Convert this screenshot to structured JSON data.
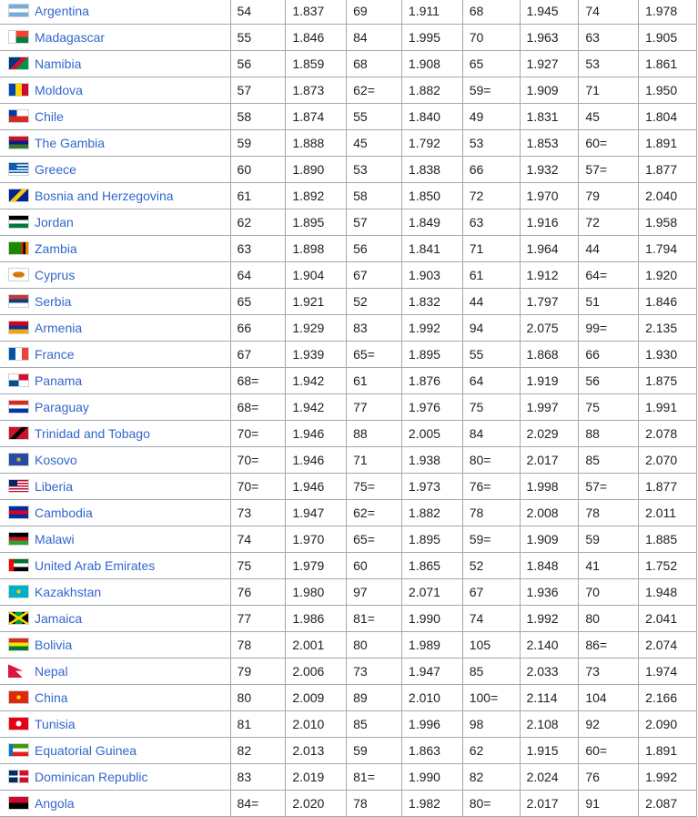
{
  "rows": [
    {
      "country": "Argentina",
      "flag": [
        "#74acdf",
        "#ffffff",
        "#74acdf"
      ],
      "dir": "h",
      "rank1": "54",
      "score1": "1.837",
      "rank2": "69",
      "score2": "1.911",
      "rank3": "68",
      "score3": "1.945",
      "rank4": "74",
      "score4": "1.978"
    },
    {
      "country": "Madagascar",
      "flag": [
        "#ffffff",
        "#fc3d32",
        "#007e3a"
      ],
      "dir": "mg",
      "rank1": "55",
      "score1": "1.846",
      "rank2": "84",
      "score2": "1.995",
      "rank3": "70",
      "score3": "1.963",
      "rank4": "63",
      "score4": "1.905"
    },
    {
      "country": "Namibia",
      "flag": [
        "#003580",
        "#d21034",
        "#009543"
      ],
      "dir": "d",
      "rank1": "56",
      "score1": "1.859",
      "rank2": "68",
      "score2": "1.908",
      "rank3": "65",
      "score3": "1.927",
      "rank4": "53",
      "score4": "1.861"
    },
    {
      "country": "Moldova",
      "flag": [
        "#0046ae",
        "#ffd200",
        "#cc092f"
      ],
      "dir": "v",
      "rank1": "57",
      "score1": "1.873",
      "rank2": "62=",
      "score2": "1.882",
      "rank3": "59=",
      "score3": "1.909",
      "rank4": "71",
      "score4": "1.950"
    },
    {
      "country": "Chile",
      "flag": [
        "#0039a6",
        "#ffffff",
        "#d52b1e"
      ],
      "dir": "cl",
      "rank1": "58",
      "score1": "1.874",
      "rank2": "55",
      "score2": "1.840",
      "rank3": "49",
      "score3": "1.831",
      "rank4": "45",
      "score4": "1.804"
    },
    {
      "country": "The Gambia",
      "flag": [
        "#ce1126",
        "#0c1c8c",
        "#3a7728"
      ],
      "dir": "h",
      "rank1": "59",
      "score1": "1.888",
      "rank2": "45",
      "score2": "1.792",
      "rank3": "53",
      "score3": "1.853",
      "rank4": "60=",
      "score4": "1.891"
    },
    {
      "country": "Greece",
      "flag": [
        "#0d5eaf",
        "#ffffff",
        "#0d5eaf"
      ],
      "dir": "gr",
      "rank1": "60",
      "score1": "1.890",
      "rank2": "53",
      "score2": "1.838",
      "rank3": "66",
      "score3": "1.932",
      "rank4": "57=",
      "score4": "1.877"
    },
    {
      "country": "Bosnia and Herzegovina",
      "flag": [
        "#002395",
        "#fecb00",
        "#002395"
      ],
      "dir": "d",
      "rank1": "61",
      "score1": "1.892",
      "rank2": "58",
      "score2": "1.850",
      "rank3": "72",
      "score3": "1.970",
      "rank4": "79",
      "score4": "2.040"
    },
    {
      "country": "Jordan",
      "flag": [
        "#000000",
        "#ffffff",
        "#007a3d"
      ],
      "dir": "h",
      "rank1": "62",
      "score1": "1.895",
      "rank2": "57",
      "score2": "1.849",
      "rank3": "63",
      "score3": "1.916",
      "rank4": "72",
      "score4": "1.958"
    },
    {
      "country": "Zambia",
      "flag": [
        "#198a00",
        "#198a00",
        "#de2010"
      ],
      "dir": "zm",
      "rank1": "63",
      "score1": "1.898",
      "rank2": "56",
      "score2": "1.841",
      "rank3": "71",
      "score3": "1.964",
      "rank4": "44",
      "score4": "1.794"
    },
    {
      "country": "Cyprus",
      "flag": [
        "#ffffff",
        "#d57800",
        "#ffffff"
      ],
      "dir": "cy",
      "rank1": "64",
      "score1": "1.904",
      "rank2": "67",
      "score2": "1.903",
      "rank3": "61",
      "score3": "1.912",
      "rank4": "64=",
      "score4": "1.920"
    },
    {
      "country": "Serbia",
      "flag": [
        "#c6363c",
        "#0c4076",
        "#ffffff"
      ],
      "dir": "h",
      "rank1": "65",
      "score1": "1.921",
      "rank2": "52",
      "score2": "1.832",
      "rank3": "44",
      "score3": "1.797",
      "rank4": "51",
      "score4": "1.846"
    },
    {
      "country": "Armenia",
      "flag": [
        "#d90012",
        "#0033a0",
        "#f2a800"
      ],
      "dir": "h",
      "rank1": "66",
      "score1": "1.929",
      "rank2": "83",
      "score2": "1.992",
      "rank3": "94",
      "score3": "2.075",
      "rank4": "99=",
      "score4": "2.135"
    },
    {
      "country": "France",
      "flag": [
        "#0055a4",
        "#ffffff",
        "#ef4135"
      ],
      "dir": "v",
      "rank1": "67",
      "score1": "1.939",
      "rank2": "65=",
      "score2": "1.895",
      "rank3": "55",
      "score3": "1.868",
      "rank4": "66",
      "score4": "1.930"
    },
    {
      "country": "Panama",
      "flag": [
        "#ffffff",
        "#d21034",
        "#005293"
      ],
      "dir": "pa",
      "rank1": "68=",
      "score1": "1.942",
      "rank2": "61",
      "score2": "1.876",
      "rank3": "64",
      "score3": "1.919",
      "rank4": "56",
      "score4": "1.875"
    },
    {
      "country": "Paraguay",
      "flag": [
        "#d52b1e",
        "#ffffff",
        "#0038a8"
      ],
      "dir": "h",
      "rank1": "68=",
      "score1": "1.942",
      "rank2": "77",
      "score2": "1.976",
      "rank3": "75",
      "score3": "1.997",
      "rank4": "75",
      "score4": "1.991"
    },
    {
      "country": "Trinidad and Tobago",
      "flag": [
        "#ce1126",
        "#000000",
        "#ce1126"
      ],
      "dir": "d",
      "rank1": "70=",
      "score1": "1.946",
      "rank2": "88",
      "score2": "2.005",
      "rank3": "84",
      "score3": "2.029",
      "rank4": "88",
      "score4": "2.078"
    },
    {
      "country": "Kosovo",
      "flag": [
        "#244aa5",
        "#d0a650",
        "#244aa5"
      ],
      "dir": "x",
      "rank1": "70=",
      "score1": "1.946",
      "rank2": "71",
      "score2": "1.938",
      "rank3": "80=",
      "score3": "2.017",
      "rank4": "85",
      "score4": "2.070"
    },
    {
      "country": "Liberia",
      "flag": [
        "#bf0a30",
        "#ffffff",
        "#002868"
      ],
      "dir": "lr",
      "rank1": "70=",
      "score1": "1.946",
      "rank2": "75=",
      "score2": "1.973",
      "rank3": "76=",
      "score3": "1.998",
      "rank4": "57=",
      "score4": "1.877"
    },
    {
      "country": "Cambodia",
      "flag": [
        "#032ea1",
        "#e00025",
        "#032ea1"
      ],
      "dir": "h",
      "rank1": "73",
      "score1": "1.947",
      "rank2": "62=",
      "score2": "1.882",
      "rank3": "78",
      "score3": "2.008",
      "rank4": "78",
      "score4": "2.011"
    },
    {
      "country": "Malawi",
      "flag": [
        "#000000",
        "#ce1126",
        "#339e35"
      ],
      "dir": "h",
      "rank1": "74",
      "score1": "1.970",
      "rank2": "65=",
      "score2": "1.895",
      "rank3": "59=",
      "score3": "1.909",
      "rank4": "59",
      "score4": "1.885"
    },
    {
      "country": "United Arab Emirates",
      "flag": [
        "#00732f",
        "#ffffff",
        "#000000"
      ],
      "dir": "ae",
      "rank1": "75",
      "score1": "1.979",
      "rank2": "60",
      "score2": "1.865",
      "rank3": "52",
      "score3": "1.848",
      "rank4": "41",
      "score4": "1.752"
    },
    {
      "country": "Kazakhstan",
      "flag": [
        "#00afca",
        "#fec50c",
        "#00afca"
      ],
      "dir": "x",
      "rank1": "76",
      "score1": "1.980",
      "rank2": "97",
      "score2": "2.071",
      "rank3": "67",
      "score3": "1.936",
      "rank4": "70",
      "score4": "1.948"
    },
    {
      "country": "Jamaica",
      "flag": [
        "#009b3a",
        "#fed100",
        "#000000"
      ],
      "dir": "jm",
      "rank1": "77",
      "score1": "1.986",
      "rank2": "81=",
      "score2": "1.990",
      "rank3": "74",
      "score3": "1.992",
      "rank4": "80",
      "score4": "2.041"
    },
    {
      "country": "Bolivia",
      "flag": [
        "#d52b1e",
        "#f9e300",
        "#007934"
      ],
      "dir": "h",
      "rank1": "78",
      "score1": "2.001",
      "rank2": "80",
      "score2": "1.989",
      "rank3": "105",
      "score3": "2.140",
      "rank4": "86=",
      "score4": "2.074"
    },
    {
      "country": "Nepal",
      "flag": [
        "#dc143c",
        "#003893",
        "#ffffff"
      ],
      "dir": "np",
      "rank1": "79",
      "score1": "2.006",
      "rank2": "73",
      "score2": "1.947",
      "rank3": "85",
      "score3": "2.033",
      "rank4": "73",
      "score4": "1.974"
    },
    {
      "country": "China",
      "flag": [
        "#de2910",
        "#ffde00",
        "#de2910"
      ],
      "dir": "x",
      "rank1": "80",
      "score1": "2.009",
      "rank2": "89",
      "score2": "2.010",
      "rank3": "100=",
      "score3": "2.114",
      "rank4": "104",
      "score4": "2.166"
    },
    {
      "country": "Tunisia",
      "flag": [
        "#e70013",
        "#ffffff",
        "#e70013"
      ],
      "dir": "tn",
      "rank1": "81",
      "score1": "2.010",
      "rank2": "85",
      "score2": "1.996",
      "rank3": "98",
      "score3": "2.108",
      "rank4": "92",
      "score4": "2.090"
    },
    {
      "country": "Equatorial Guinea",
      "flag": [
        "#3e9a00",
        "#ffffff",
        "#e32118"
      ],
      "dir": "gq",
      "rank1": "82",
      "score1": "2.013",
      "rank2": "59",
      "score2": "1.863",
      "rank3": "62",
      "score3": "1.915",
      "rank4": "60=",
      "score4": "1.891"
    },
    {
      "country": "Dominican Republic",
      "flag": [
        "#002d62",
        "#ffffff",
        "#ce1126"
      ],
      "dir": "do",
      "rank1": "83",
      "score1": "2.019",
      "rank2": "81=",
      "score2": "1.990",
      "rank3": "82",
      "score3": "2.024",
      "rank4": "76",
      "score4": "1.992"
    },
    {
      "country": "Angola",
      "flag": [
        "#cc092f",
        "#000000",
        "#ffcb00"
      ],
      "dir": "ao",
      "rank1": "84=",
      "score1": "2.020",
      "rank2": "78",
      "score2": "1.982",
      "rank3": "80=",
      "score3": "2.017",
      "rank4": "91",
      "score4": "2.087"
    }
  ]
}
